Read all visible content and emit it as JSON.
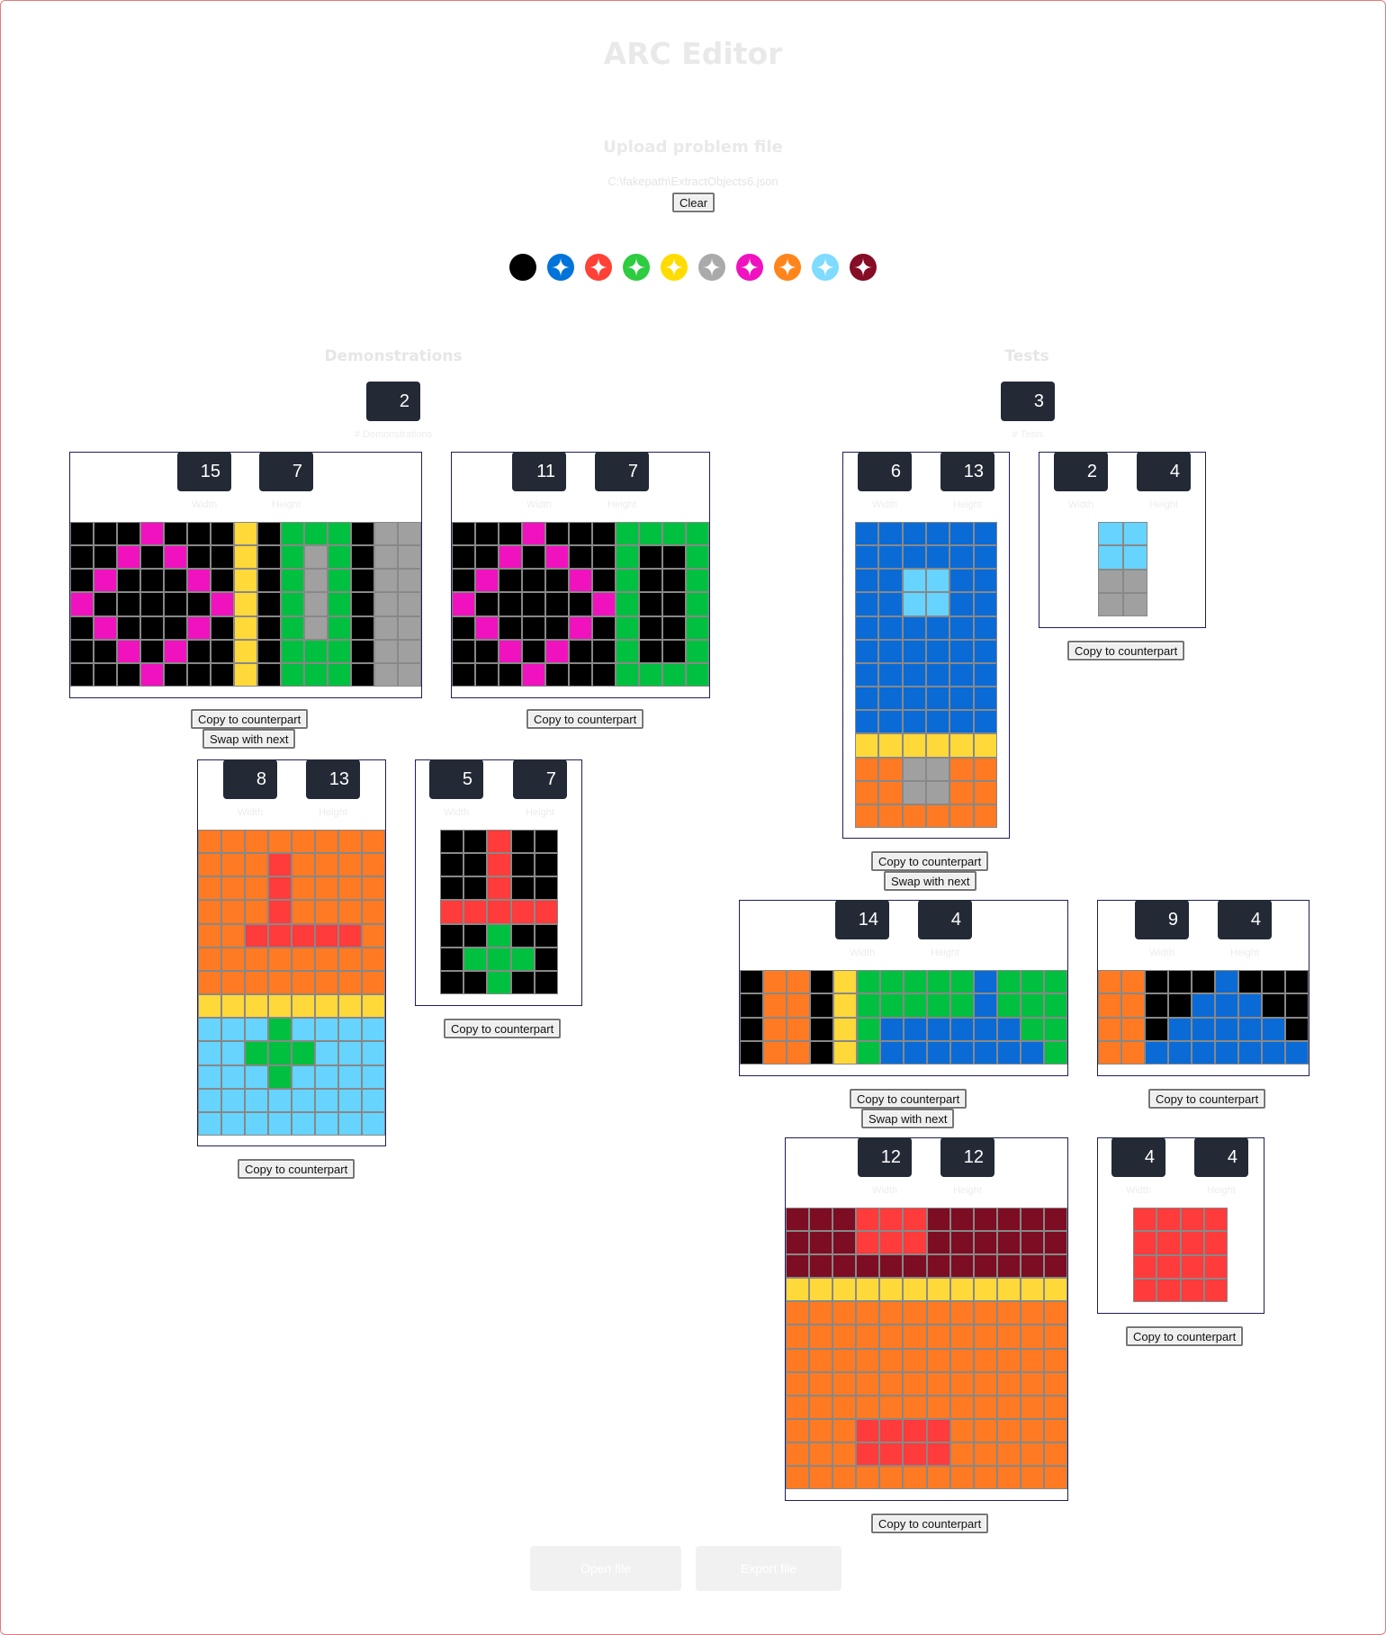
{
  "app_title": "ARC Editor",
  "upload": {
    "title": "Upload problem file",
    "file_path": "C:\\fakepath\\ExtractObjects6.json",
    "clear_label": "Clear"
  },
  "palette": [
    "#000000",
    "#0074d9",
    "#ff4136",
    "#2ecc40",
    "#ffdc00",
    "#aaaaaa",
    "#f012be",
    "#ff851b",
    "#7fdbff",
    "#870c25"
  ],
  "colors": {
    "0": "#000000",
    "1": "#0a6bd6",
    "2": "#ff3b3b",
    "3": "#00c040",
    "4": "#ffd83a",
    "5": "#a0a0a0",
    "6": "#f012be",
    "7": "#ff7a22",
    "8": "#66d4ff",
    "9": "#7d0d22"
  },
  "demonstrations": {
    "title": "Demonstrations",
    "count": "2",
    "count_label": "# Demonstrations"
  },
  "tests": {
    "title": "Tests",
    "count": "3",
    "count_label": "# Tests"
  },
  "labels": {
    "width": "Width",
    "height": "Height",
    "copy": "Copy to counterpart",
    "swap": "Swap with next"
  },
  "grids": [
    {
      "id": "demo1-in",
      "width": "15",
      "height": "7",
      "rows": [
        "000600040333055",
        "006060040353055",
        "060006040353055",
        "600000640353055",
        "060006040353055",
        "006060040333055",
        "000600040333055"
      ]
    },
    {
      "id": "demo1-out",
      "width": "11",
      "height": "7",
      "rows": [
        "00060003333",
        "00606003003",
        "06000603003",
        "60000063003",
        "06000603003",
        "00606003003",
        "00060003333"
      ]
    },
    {
      "id": "demo2-in",
      "width": "8",
      "height": "13",
      "rows": [
        "77777777",
        "77727777",
        "77727777",
        "77727777",
        "77222227",
        "77777777",
        "77777777",
        "44444444",
        "88838888",
        "88333888",
        "88838888",
        "88888888",
        "88888888"
      ]
    },
    {
      "id": "demo2-out",
      "width": "5",
      "height": "7",
      "rows": [
        "00200",
        "00200",
        "00200",
        "22222",
        "00300",
        "03330",
        "00300"
      ]
    },
    {
      "id": "test1-in",
      "width": "6",
      "height": "13",
      "rows": [
        "111111",
        "111111",
        "118811",
        "118811",
        "111111",
        "111111",
        "111111",
        "111111",
        "111111",
        "444444",
        "775577",
        "775577",
        "777777"
      ]
    },
    {
      "id": "test1-out",
      "width": "2",
      "height": "4",
      "rows": [
        "88",
        "88",
        "55",
        "55"
      ]
    },
    {
      "id": "test2-in",
      "width": "14",
      "height": "4",
      "rows": [
        "07704333331333",
        "07704333331333",
        "07704311111133",
        "07704311111113"
      ]
    },
    {
      "id": "test2-out",
      "width": "9",
      "height": "4",
      "rows": [
        "770001000",
        "770011100",
        "770111110",
        "771111111"
      ]
    },
    {
      "id": "test3-in",
      "width": "12",
      "height": "12",
      "rows": [
        "999222999999",
        "999222999999",
        "999999999999",
        "444444444444",
        "777777777777",
        "777777777777",
        "777777777777",
        "777777777777",
        "777777777777",
        "777222277777",
        "777222277777",
        "777777777777"
      ]
    },
    {
      "id": "test3-out",
      "width": "4",
      "height": "4",
      "rows": [
        "2222",
        "2222",
        "2222",
        "2222"
      ]
    }
  ],
  "bottom_buttons": {
    "open": "Open file",
    "export": "Export file"
  }
}
